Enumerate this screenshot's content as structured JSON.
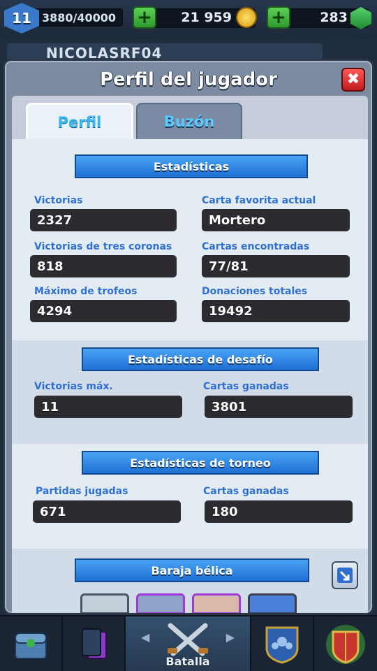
{
  "hud": {
    "level": "11",
    "experience": "3880/40000",
    "experience_fraction": 0.097,
    "gold": "21 959",
    "gems": "283"
  },
  "player_name": "NICOLASRF04",
  "modal": {
    "title": "Perfil del jugador",
    "close_icon": "✖",
    "tabs": [
      {
        "label": "Perfil",
        "active": true
      },
      {
        "label": "Buzón",
        "active": false
      }
    ]
  },
  "stats": {
    "heading": "Estadísticas",
    "items": [
      {
        "label": "Victorias",
        "value": "2327"
      },
      {
        "label": "Carta favorita actual",
        "value": "Mortero"
      },
      {
        "label": "Victorias de tres coronas",
        "value": "818"
      },
      {
        "label": "Cartas encontradas",
        "value": "77/81"
      },
      {
        "label": "Máximo de trofeos",
        "value": "4294"
      },
      {
        "label": "Donaciones totales",
        "value": "19492"
      }
    ]
  },
  "challenge": {
    "heading": "Estadísticas de desafío",
    "items": [
      {
        "label": "Victorias máx.",
        "value": "11"
      },
      {
        "label": "Cartas ganadas",
        "value": "3801"
      }
    ]
  },
  "tournament": {
    "heading": "Estadísticas de torneo",
    "items": [
      {
        "label": "Partidas jugadas",
        "value": "671"
      },
      {
        "label": "Cartas ganadas",
        "value": "180"
      }
    ]
  },
  "deck": {
    "heading": "Baraja bélica"
  },
  "bottom_nav": {
    "items": [
      {
        "icon": "chest-shop-icon"
      },
      {
        "icon": "cards-icon"
      },
      {
        "icon": "crossed-swords-icon",
        "label": "Batalla"
      },
      {
        "icon": "clan-shield-icon"
      },
      {
        "icon": "tournament-shield-icon"
      }
    ]
  },
  "colors": {
    "ribbon": "#2a86e6",
    "label_blue": "#2f6fd6",
    "value_box": "#2c2c30",
    "close_red": "#d62828",
    "plus_green": "#3dba38"
  }
}
